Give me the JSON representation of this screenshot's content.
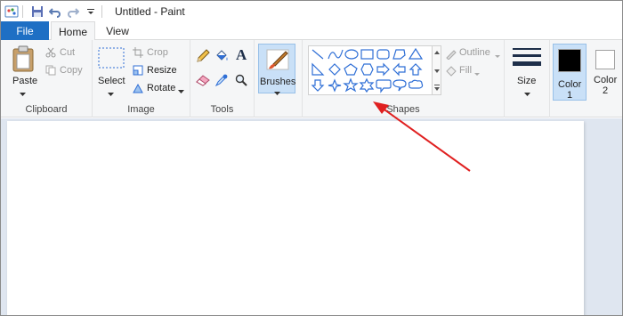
{
  "window": {
    "title": "Untitled - Paint"
  },
  "tabs": {
    "file": "File",
    "home": "Home",
    "view": "View"
  },
  "clipboard": {
    "paste": "Paste",
    "cut": "Cut",
    "copy": "Copy",
    "group": "Clipboard"
  },
  "image": {
    "select": "Select",
    "crop": "Crop",
    "resize": "Resize",
    "rotate": "Rotate",
    "group": "Image"
  },
  "tools": {
    "group": "Tools"
  },
  "brushes": {
    "label": "Brushes"
  },
  "shapes": {
    "outline": "Outline",
    "fill": "Fill",
    "group": "Shapes"
  },
  "size": {
    "label": "Size"
  },
  "colors": {
    "color1_line1": "Color",
    "color1_line2": "1",
    "color2_line1": "Color",
    "color2_line2": "2",
    "color1_value": "#000000",
    "color2_value": "#ffffff"
  },
  "accent": {
    "file_tab": "#1e6fc4",
    "annotation_arrow": "#e02020"
  }
}
